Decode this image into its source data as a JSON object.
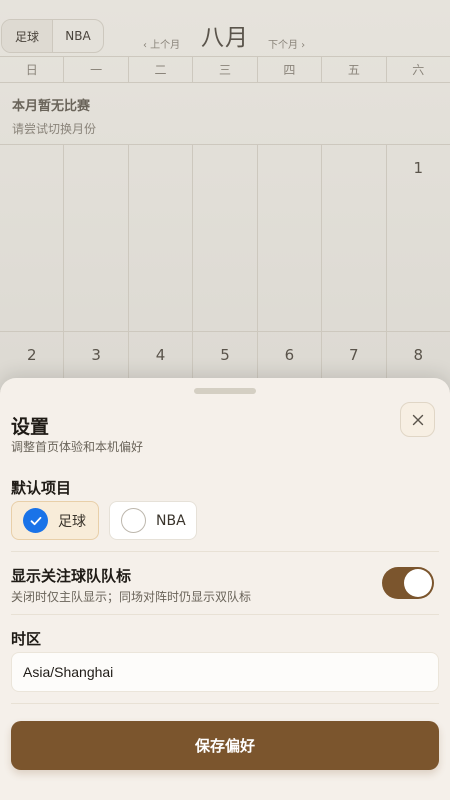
{
  "calendar": {
    "sport_tabs": [
      "足球",
      "NBA"
    ],
    "prev_month": "‹ 上个月",
    "next_month": "下个月 ›",
    "month": "八月",
    "weekdays": [
      "日",
      "一",
      "二",
      "三",
      "四",
      "五",
      "六"
    ],
    "empty_title": "本月暂无比赛",
    "empty_hint": "请尝试切换月份",
    "week1_days": [
      "",
      "",
      "",
      "",
      "",
      "",
      "1"
    ],
    "week2_days": [
      "2",
      "3",
      "4",
      "5",
      "6",
      "7",
      "8"
    ]
  },
  "settings": {
    "title": "设置",
    "subtitle": "调整首页体验和本机偏好",
    "close_icon": "close-icon",
    "default_sport": {
      "label": "默认项目",
      "options": [
        {
          "label": "足球",
          "selected": true
        },
        {
          "label": "NBA",
          "selected": false
        }
      ]
    },
    "team_logo": {
      "label": "显示关注球队队标",
      "description": "关闭时仅主队显示；同场对阵时仍显示双队标",
      "enabled": true
    },
    "timezone": {
      "label": "时区",
      "value": "Asia/Shanghai"
    },
    "save_label": "保存偏好"
  },
  "colors": {
    "accent": "#7b552d",
    "radio_selected": "#1a73e8",
    "sheet_bg": "#f5f0ea"
  }
}
